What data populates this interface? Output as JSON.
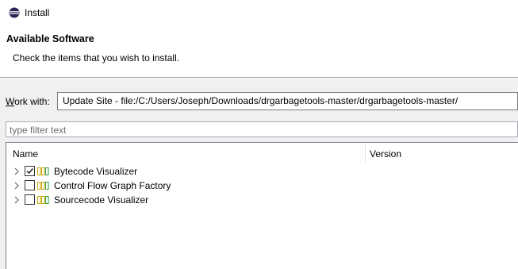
{
  "window": {
    "title": "Install"
  },
  "header": {
    "heading": "Available Software",
    "description": "Check the items that you wish to install."
  },
  "work_with": {
    "label_prefix": "",
    "label_mnemonic": "W",
    "label_rest": "ork with:",
    "value": "Update Site - file:/C:/Users/Joseph/Downloads/drgarbagetools-master/drgarbagetools-master/"
  },
  "filter": {
    "placeholder": "type filter text",
    "value": ""
  },
  "tree": {
    "columns": [
      "Name",
      "Version"
    ],
    "items": [
      {
        "label": "Bytecode Visualizer",
        "checked": true
      },
      {
        "label": "Control Flow Graph Factory",
        "checked": false
      },
      {
        "label": "Sourcecode Visualizer",
        "checked": false
      }
    ]
  },
  "colors": {
    "package_icon": "#c8a400",
    "border": "#828790"
  }
}
